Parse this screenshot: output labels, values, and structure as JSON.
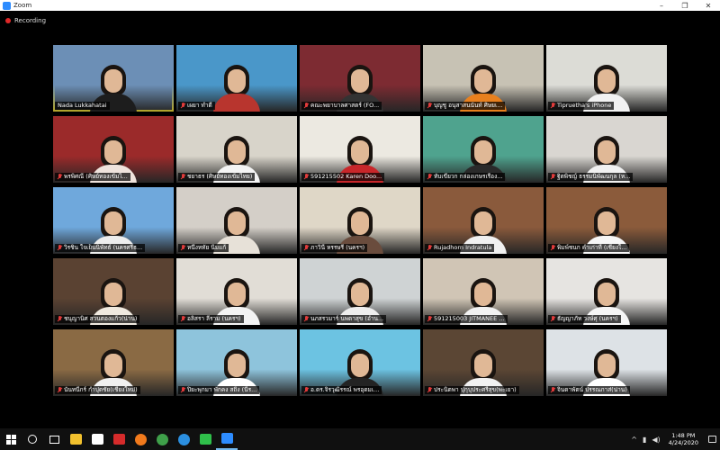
{
  "window": {
    "title": "Zoom",
    "minimize": "–",
    "maximize": "❐",
    "close": "✕"
  },
  "recording": {
    "label": "Recording",
    "color": "#e02828"
  },
  "active_speaker_color": "#f0dc36",
  "participants": [
    {
      "name": "Nada Lukkahatai",
      "muted": false,
      "active": true,
      "bg": "#6c8fb6",
      "shirt": "#1d1d1d",
      "scene": "building-icon"
    },
    {
      "name": "เผยา ทำดี",
      "muted": true,
      "active": false,
      "bg": "#4a97c9",
      "shirt": "#b8352e"
    },
    {
      "name": "คณะพยาบาลศาสตร์ (FO...",
      "muted": true,
      "active": false,
      "bg": "#7d2b32",
      "shirt": "#333333",
      "scene": "auditorium-icon"
    },
    {
      "name": "บุญชู อนุสาสนนันท์ ศิษยเ...",
      "muted": true,
      "active": false,
      "bg": "#c7c2b4",
      "shirt": "#e8801e"
    },
    {
      "name": "Tipruetha's iPhone",
      "muted": true,
      "active": false,
      "bg": "#dcdcd6",
      "shirt": "#f2f2f2"
    },
    {
      "name": "พรพิศณี (ศิษย์ทองเข้มไ...",
      "muted": true,
      "active": false,
      "bg": "#9b2a2a",
      "shirt": "#efe3dc"
    },
    {
      "name": "ชยาธร (ศิษย์ทองเข้มไทย)",
      "muted": true,
      "active": false,
      "bg": "#d8d4ca",
      "shirt": "#f4f4f4"
    },
    {
      "name": "591215502 Karen Doo...",
      "muted": true,
      "active": false,
      "bg": "#ece9e1",
      "shirt": "#c8262a"
    },
    {
      "name": "ทับเขียวก กล่องเกษรเรือง...",
      "muted": true,
      "active": false,
      "bg": "#4fa38e",
      "shirt": "#2a2a2a"
    },
    {
      "name": "ฐิตพิชญ์ ธรรมนิพัฒนกุล (ห...",
      "muted": true,
      "active": false,
      "bg": "#d9d6d1",
      "shirt": "#f1f1f1"
    },
    {
      "name": "วิรชิน ใจเย็นนิพัทธ์ (นครศรีธ...",
      "muted": true,
      "active": false,
      "bg": "#6fa8dc",
      "shirt": "#ededed"
    },
    {
      "name": "หนึ่งหทัย นิ่มแก้",
      "muted": true,
      "active": false,
      "bg": "#d4cfc8",
      "shirt": "#e7e1d8"
    },
    {
      "name": "ภาวินี หรรษรี (นครฯ)",
      "muted": true,
      "active": false,
      "bg": "#dfd7c7",
      "shirt": "#6a4c3d"
    },
    {
      "name": "Rujadhorn Indratula",
      "muted": true,
      "active": false,
      "bg": "#8a5a3c",
      "shirt": "#f0f0f0"
    },
    {
      "name": "พิมพ์ชนก คำเก่าที่ (เชียงใ...",
      "muted": true,
      "active": false,
      "bg": "#8b5b3b",
      "shirt": "#f6f6f6"
    },
    {
      "name": "ชนุญานิศ สวนตองแก้ว(น่าน)",
      "muted": true,
      "active": false,
      "bg": "#5a4232",
      "shirt": "#efe9df"
    },
    {
      "name": "อลิสรา ลีราม (นครฯ)",
      "muted": true,
      "active": false,
      "bg": "#e1ddd6",
      "shirt": "#f3f3f3"
    },
    {
      "name": "นภสรวมาร์ นพดาสุข (อำน...",
      "muted": true,
      "active": false,
      "bg": "#cfd3d4",
      "shirt": "#eeeeee"
    },
    {
      "name": "591215003 JITMANEE ...",
      "muted": true,
      "active": false,
      "bg": "#d0c5b5",
      "shirt": "#f2f2f2"
    },
    {
      "name": "ธัญญาภัท วงษ์ศุ (นครฯ)",
      "muted": true,
      "active": false,
      "bg": "#e6e4e1",
      "shirt": "#f6f6f6"
    },
    {
      "name": "นันทนีกร์ กำปุดชัย(เชียงใหม่)",
      "muted": true,
      "active": false,
      "bg": "#8a6a44",
      "shirt": "#f0f0f0"
    },
    {
      "name": "ปิยะพุกมา พักคง สถิ่ง (นีร...",
      "muted": true,
      "active": false,
      "bg": "#8ec4dc",
      "shirt": "#ffffff",
      "scene": "glacier-icon"
    },
    {
      "name": "อ.ดร.จิรวุฒิรรณ์ พรอุดมเ...",
      "muted": true,
      "active": false,
      "bg": "#6cc3e2",
      "shirt": "#232323",
      "scene": "palm-beach-icon"
    },
    {
      "name": "ประนิตพา ปุกุบุประศรีสุข(พะเยา)",
      "muted": true,
      "active": false,
      "bg": "#5b4634",
      "shirt": "#f1f1f1",
      "scene": "library-icon"
    },
    {
      "name": "จินดาพัตน์ ปรรณภาส่(น่าน)",
      "muted": true,
      "active": false,
      "bg": "#dde2e6",
      "shirt": "#ffffff"
    }
  ],
  "taskbar": {
    "apps": [
      {
        "name": "file-explorer-icon",
        "color": "#f2c12e",
        "running": false
      },
      {
        "name": "mail-icon",
        "color": "#ffffff",
        "running": false
      },
      {
        "name": "pdf-icon",
        "color": "#d62b2b",
        "running": false
      },
      {
        "name": "firefox-icon",
        "color": "#f27a1c",
        "running": false
      },
      {
        "name": "chrome-icon",
        "color": "#3fa04a",
        "running": false
      },
      {
        "name": "edge-icon",
        "color": "#2b8fe0",
        "running": false
      },
      {
        "name": "line-icon",
        "color": "#2fbf4a",
        "running": false
      },
      {
        "name": "zoom-icon",
        "color": "#2d8cff",
        "running": true
      }
    ],
    "tray_arrow": "^",
    "time": "1:48 PM",
    "date": "4/24/2020"
  }
}
